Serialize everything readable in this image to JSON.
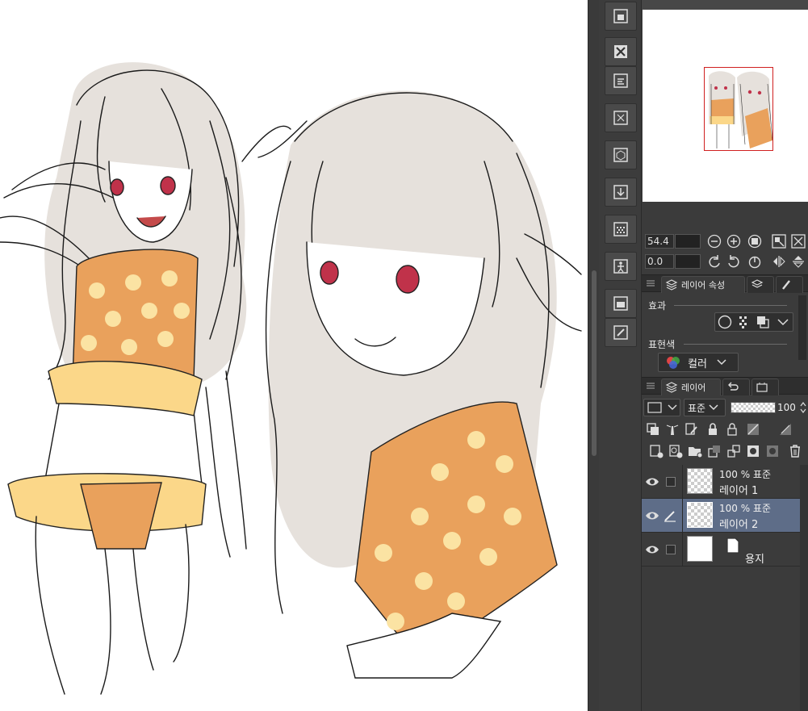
{
  "colors": {
    "panel_bg": "#3b3b3b",
    "selected_layer": "#5e6d88",
    "nav_frame": "#d02020",
    "accent_orange": "#e9a15c",
    "dot_yellow": "#fbe3a3"
  },
  "command_bar": {
    "buttons": [
      {
        "icon": "save-to-cloud-icon"
      },
      {
        "icon": "clear-icon"
      },
      {
        "icon": "layer-settings-icon"
      },
      {
        "icon": "transform-icon"
      },
      {
        "icon": "3d-material-icon"
      },
      {
        "icon": "import-icon"
      },
      {
        "icon": "tone-icon"
      },
      {
        "icon": "pose-model-icon"
      },
      {
        "icon": "layer-property-icon"
      },
      {
        "icon": "edit-icon"
      }
    ]
  },
  "navigator": {
    "zoom_value": "54.4",
    "rotation_value": "0.0"
  },
  "layer_property_panel": {
    "tab_label": "레이어 속성",
    "effect_label": "효과",
    "expression_color_label": "표현색",
    "color_mode_value": "컬러"
  },
  "layer_panel": {
    "tab_label": "레이어",
    "blend_mode": "표준",
    "opacity": "100",
    "layers": [
      {
        "opacity_mode": "100 % 표준",
        "name": "레이어 1",
        "selected": false,
        "type": "raster"
      },
      {
        "opacity_mode": "100 % 표준",
        "name": "레이어 2",
        "selected": true,
        "type": "raster"
      },
      {
        "name": "용지",
        "selected": false,
        "type": "paper"
      }
    ]
  }
}
